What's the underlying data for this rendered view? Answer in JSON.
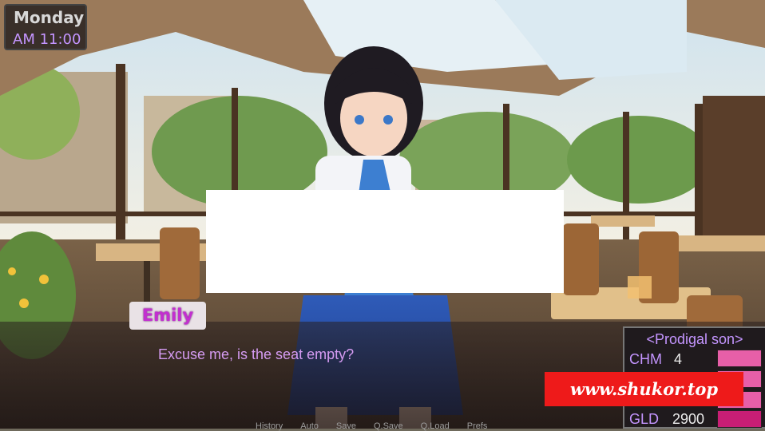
{
  "time": {
    "day": "Monday",
    "clock": "AM 11:00"
  },
  "dialogue": {
    "speaker": "Emily",
    "text": "Excuse me, is the seat empty?"
  },
  "quick_menu": [
    "History",
    "Auto",
    "Save",
    "Q.Save",
    "Q.Load",
    "Prefs"
  ],
  "stats": {
    "title": "<Prodigal son>",
    "items": [
      {
        "label": "CHM",
        "value": "4",
        "level": 1.0,
        "color": "#e75fa8"
      },
      {
        "label": "",
        "value": "",
        "level": 1.0,
        "color": "#e75fa8"
      },
      {
        "label": "",
        "value": "",
        "level": 1.0,
        "color": "#e75fa8"
      },
      {
        "label": "GLD",
        "value": "2900",
        "level": 1.0,
        "color": "#c81e75"
      }
    ]
  },
  "watermark": "www.shukor.top"
}
